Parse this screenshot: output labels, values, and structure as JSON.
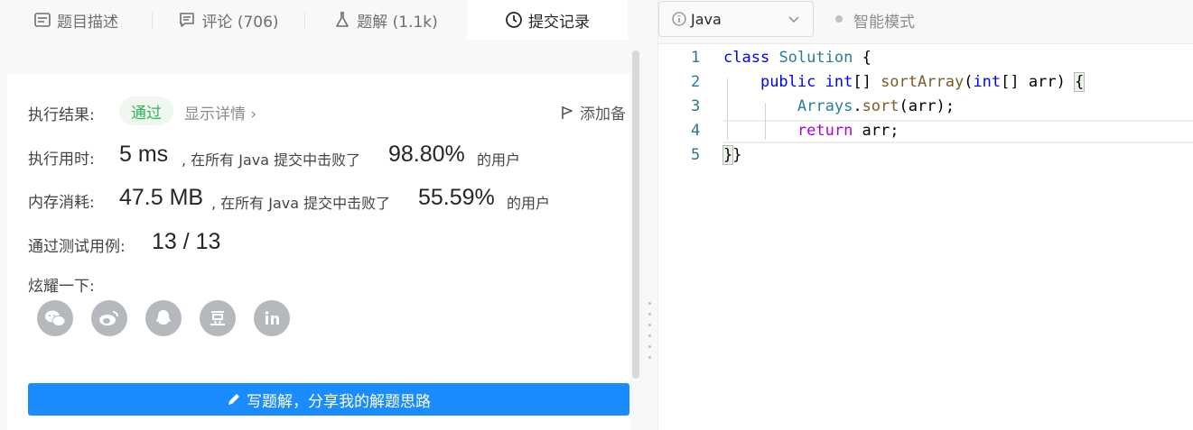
{
  "tabs": [
    {
      "label": "题目描述",
      "icon": "description-icon"
    },
    {
      "label": "评论 (706)",
      "icon": "comment-icon"
    },
    {
      "label": "题解 (1.1k)",
      "icon": "flask-icon"
    },
    {
      "label": "提交记录",
      "icon": "clock-icon"
    }
  ],
  "result": {
    "label": "执行结果:",
    "status": "通过",
    "details": "显示详情 ›",
    "add_note": "添加备"
  },
  "runtime": {
    "label": "执行用时:",
    "value": "5 ms",
    "text": ", 在所有 Java 提交中击败了",
    "percent": "98.80%",
    "suffix": "的用户"
  },
  "memory": {
    "label": "内存消耗:",
    "value": "47.5 MB",
    "text": ", 在所有 Java 提交中击败了",
    "percent": "55.59%",
    "suffix": "的用户"
  },
  "testcases": {
    "label": "通过测试用例:",
    "value": "13 / 13"
  },
  "share": {
    "label": "炫耀一下:",
    "icons": [
      "wechat-icon",
      "weibo-icon",
      "qq-icon",
      "douban-icon",
      "linkedin-icon"
    ]
  },
  "write_button": "写题解，分享我的解题思路",
  "editor": {
    "language": "Java",
    "mode": "智能模式",
    "line_numbers": [
      "1",
      "2",
      "3",
      "4",
      "5"
    ]
  },
  "colors": {
    "accent": "#1a8cff",
    "pass": "#2db55d"
  }
}
